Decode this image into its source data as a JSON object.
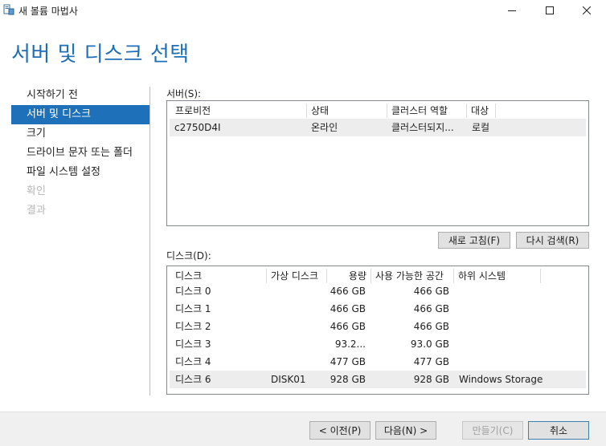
{
  "window": {
    "title": "새 볼륨 마법사",
    "icon": "volume-wizard-icon"
  },
  "heading": "서버 및 디스크 선택",
  "nav": {
    "items": [
      {
        "label": "시작하기 전",
        "state": "normal"
      },
      {
        "label": "서버 및 디스크",
        "state": "active"
      },
      {
        "label": "크기",
        "state": "normal"
      },
      {
        "label": "드라이브 문자 또는 폴더",
        "state": "normal"
      },
      {
        "label": "파일 시스템 설정",
        "state": "normal"
      },
      {
        "label": "확인",
        "state": "disabled"
      },
      {
        "label": "결과",
        "state": "disabled"
      }
    ]
  },
  "servers": {
    "label": "서버(S):",
    "columns": [
      "프로비전",
      "상태",
      "클러스터 역할",
      "대상"
    ],
    "rows": [
      {
        "provision": "c2750D4I",
        "status": "온라인",
        "cluster_role": "클러스터되지...",
        "target": "로컬",
        "selected": true
      }
    ]
  },
  "buttons": {
    "refresh": "새로 고침(F)",
    "rescan": "다시 검색(R)"
  },
  "disks": {
    "label": "디스크(D):",
    "columns": [
      "디스크",
      "가상 디스크",
      "용량",
      "사용 가능한 공간",
      "하위 시스템"
    ],
    "rows": [
      {
        "disk": "디스크 0",
        "virtual_disk": "",
        "capacity": "466 GB",
        "free": "466 GB",
        "subsystem": "",
        "selected": false
      },
      {
        "disk": "디스크 1",
        "virtual_disk": "",
        "capacity": "466 GB",
        "free": "466 GB",
        "subsystem": "",
        "selected": false
      },
      {
        "disk": "디스크 2",
        "virtual_disk": "",
        "capacity": "466 GB",
        "free": "466 GB",
        "subsystem": "",
        "selected": false
      },
      {
        "disk": "디스크 3",
        "virtual_disk": "",
        "capacity": "93.2...",
        "free": "93.0 GB",
        "subsystem": "",
        "selected": false
      },
      {
        "disk": "디스크 4",
        "virtual_disk": "",
        "capacity": "477 GB",
        "free": "477 GB",
        "subsystem": "",
        "selected": false
      },
      {
        "disk": "디스크 6",
        "virtual_disk": "DISK01",
        "capacity": "928 GB",
        "free": "928 GB",
        "subsystem": "Windows Storage",
        "selected": true
      }
    ]
  },
  "footer": {
    "prev": "< 이전(P)",
    "next": "다음(N) >",
    "create": "만들기(C)",
    "cancel": "취소"
  },
  "colors": {
    "accent": "#1e71b8",
    "heading": "#1e6fb7",
    "disabled_text": "#b7b7b7"
  }
}
